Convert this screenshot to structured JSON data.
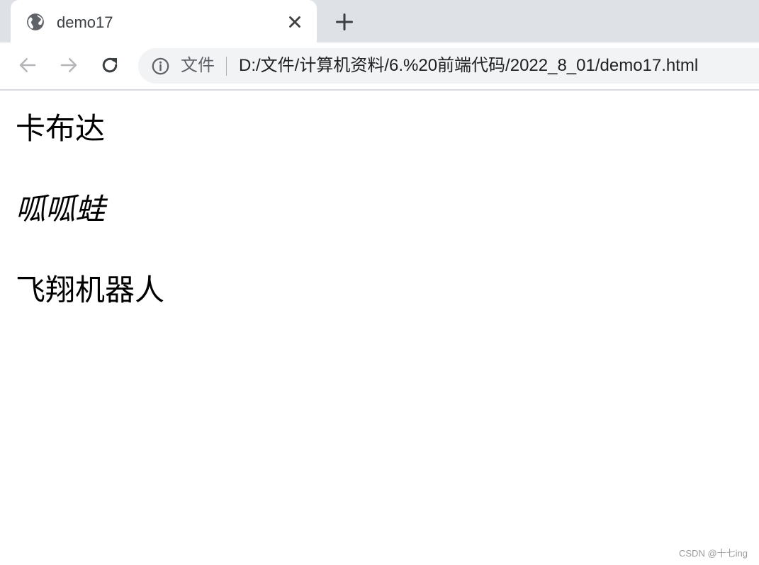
{
  "tab": {
    "title": "demo17",
    "icon": "globe-icon"
  },
  "toolbar": {
    "back_icon": "arrow-left-icon",
    "forward_icon": "arrow-right-icon",
    "reload_icon": "reload-icon",
    "security_chip": "文件",
    "url": "D:/文件/计算机资料/6.%20前端代码/2022_8_01/demo17.html"
  },
  "page": {
    "lines": [
      {
        "text": "卡布达",
        "italic": false
      },
      {
        "text": "呱呱蛙",
        "italic": true
      },
      {
        "text": "飞翔机器人",
        "italic": false
      }
    ]
  },
  "watermark": "CSDN @十七ing",
  "colors": {
    "tabstrip_bg": "#dee1e6",
    "omnibox_bg": "#f1f3f4",
    "text": "#000000"
  }
}
